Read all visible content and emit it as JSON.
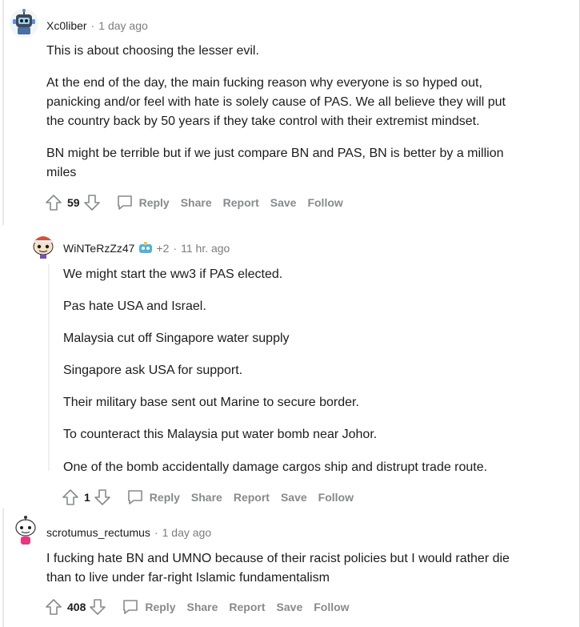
{
  "comments": [
    {
      "username": "Xc0liber",
      "time": "1 day ago",
      "paragraphs": [
        "This is about choosing the lesser evil.",
        "At the end of the day, the main fucking reason why everyone is so hyped out,",
        "panicking and/or feel with hate is solely cause of PAS. We all believe they will put",
        "the country back by 50 years if they take control with their extremist mindset.",
        "BN might be terrible but if we just compare BN and PAS, BN is better by a million",
        "miles"
      ],
      "score": "59"
    },
    {
      "username": "WiNTeRzZz47",
      "flair": "+2",
      "time": "11 hr. ago",
      "paragraphs": [
        "We might start the ww3 if PAS elected.",
        "Pas hate USA and Israel.",
        "Malaysia cut off Singapore water supply",
        "Singapore ask USA for support.",
        "Their military base sent out Marine to secure border.",
        "To counteract this Malaysia put water bomb near Johor.",
        "One of the bomb accidentally damage cargos ship and distrupt trade route."
      ],
      "score": "1"
    },
    {
      "username": "scrotumus_rectumus",
      "time": "1 day ago",
      "paragraphs": [
        "I fucking hate BN and UMNO because of their racist policies but I would rather die",
        "than to live under far-right Islamic fundamentalism"
      ],
      "score": "408"
    }
  ],
  "actions": {
    "reply": "Reply",
    "share": "Share",
    "report": "Report",
    "save": "Save",
    "follow": "Follow"
  },
  "separator": "·",
  "colors": {
    "text": "#1c1c1c",
    "meta": "#7c7c7c",
    "action": "#878a8c",
    "thread_line": "#edeff1"
  }
}
